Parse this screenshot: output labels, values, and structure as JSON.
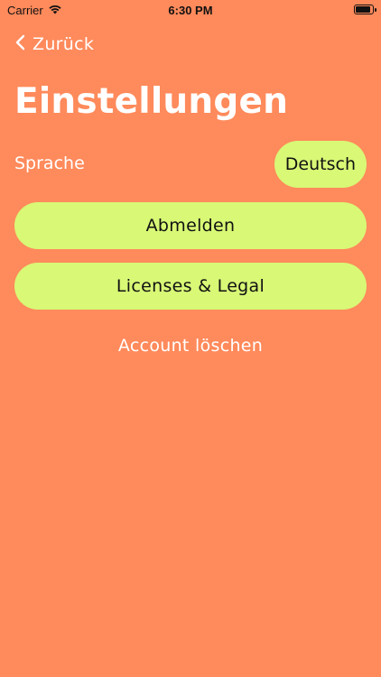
{
  "status_bar": {
    "carrier": "Carrier",
    "time": "6:30 PM",
    "icons": [
      "wifi-icon",
      "battery-icon"
    ]
  },
  "nav": {
    "back_label": "Zurück",
    "back_icon": "chevron-left-icon"
  },
  "title": "Einstellungen",
  "language": {
    "label": "Sprache",
    "value": "Deutsch"
  },
  "buttons": {
    "logout": "Abmelden",
    "licenses": "Licenses & Legal"
  },
  "delete_account": "Account löschen",
  "colors": {
    "background": "#FF8A5B",
    "button": "#D8F876",
    "text_light": "#FFFFFF",
    "text_dark": "#111111"
  }
}
